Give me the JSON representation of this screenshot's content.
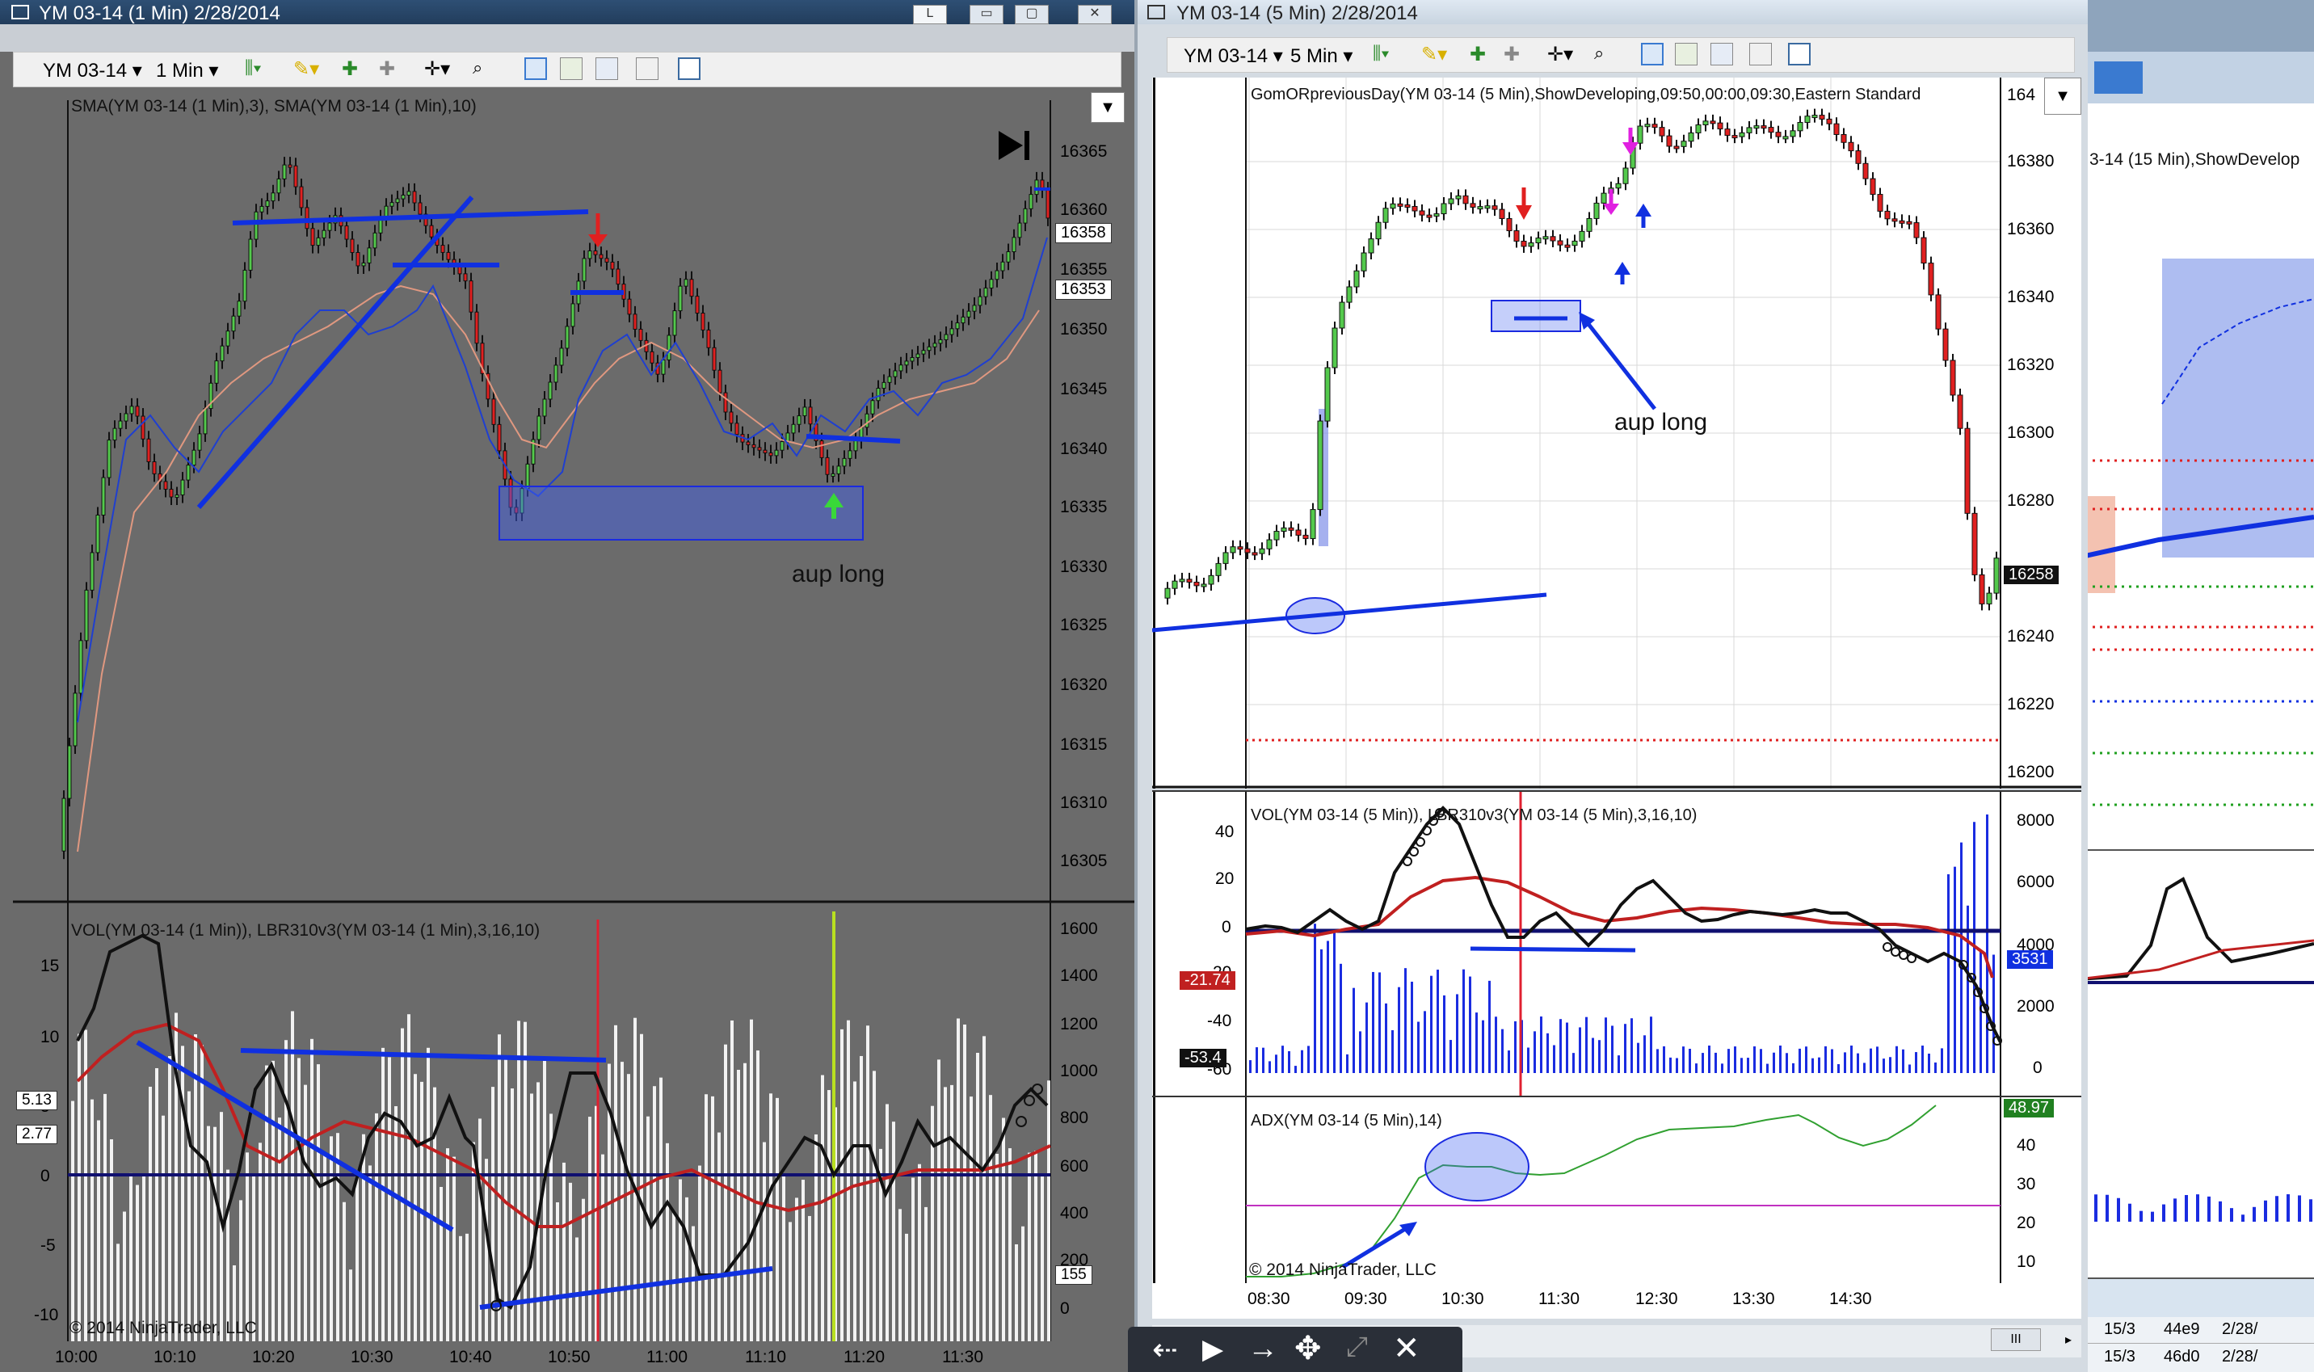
{
  "left_window": {
    "title": "YM 03-14 (1 Min)  2/28/2014",
    "toolbar": {
      "instrument": "YM 03-14",
      "interval": "1 Min"
    },
    "price_panel": {
      "indicator_label": "SMA(YM 03-14 (1 Min),3), SMA(YM 03-14 (1 Min),10)",
      "y_ticks": [
        "16365",
        "16360",
        "16355",
        "16350",
        "16345",
        "16340",
        "16335",
        "16330",
        "16325",
        "16320",
        "16315",
        "16310",
        "16305"
      ],
      "price_tags": [
        {
          "text": "16358",
          "bg": "#ffffff",
          "fg": "#000000"
        },
        {
          "text": "16353",
          "bg": "#ffffff",
          "fg": "#000000"
        }
      ],
      "annotation": "aup long"
    },
    "lower_panel": {
      "indicator_label": "VOL(YM 03-14 (1 Min)), LBR310v3(YM 03-14 (1 Min),3,16,10)",
      "y_ticks_left": [
        "15",
        "10",
        "5",
        "0",
        "-5",
        "-10"
      ],
      "y_ticks_right": [
        "1600",
        "1400",
        "1200",
        "1000",
        "800",
        "600",
        "400",
        "200",
        "0"
      ],
      "tags_left": [
        "5.13",
        "2.77"
      ],
      "tag_right": "155",
      "copyright": "© 2014 NinjaTrader, LLC"
    },
    "x_ticks": [
      "10:00",
      "10:10",
      "10:20",
      "10:30",
      "10:40",
      "10:50",
      "11:00",
      "11:10",
      "11:20",
      "11:30"
    ]
  },
  "right_window": {
    "title": "YM 03-14 (5 Min)  2/28/2014",
    "toolbar": {
      "instrument": "YM 03-14",
      "interval": "5 Min"
    },
    "price_panel": {
      "indicator_label": "GomORpreviousDay(YM 03-14 (5 Min),ShowDeveloping,09:50,00:00,09:30,Eastern Standard",
      "y_ticks": [
        "164",
        "16380",
        "16360",
        "16340",
        "16320",
        "16300",
        "16280",
        "16260",
        "16240",
        "16220",
        "16200"
      ],
      "last_price_tag": "16258",
      "annotation": "aup long"
    },
    "vol_panel": {
      "indicator_label": "VOL(YM 03-14 (5 Min)), LBR310v3(YM 03-14 (5 Min),3,16,10)",
      "y_ticks_left": [
        "40",
        "20",
        "0",
        "-20",
        "-40",
        "-60"
      ],
      "y_ticks_right": [
        "8000",
        "6000",
        "4000",
        "2000",
        "0"
      ],
      "tag_red": "-21.74",
      "tag_black": "-53.4",
      "tag_blue": "3531"
    },
    "adx_panel": {
      "indicator_label": "ADX(YM 03-14 (5 Min),14)",
      "y_ticks": [
        "40",
        "30",
        "20",
        "10"
      ],
      "tag_green": "48.97",
      "copyright": "© 2014 NinjaTrader, LLC"
    },
    "x_ticks": [
      "08:30",
      "09:30",
      "10:30",
      "11:30",
      "12:30",
      "13:30",
      "14:30"
    ],
    "scroll_label": "III"
  },
  "third_window": {
    "label": "3-14 (15 Min),ShowDevelop",
    "table_rows": [
      [
        "15/3",
        "44e9",
        "2/28/"
      ],
      [
        "15/3",
        "46d0",
        "2/28/"
      ]
    ]
  },
  "drawing_toolbar": {
    "icons": [
      "arrow-left-icon",
      "play-icon",
      "arrow-right-icon",
      "move-icon",
      "resize-icon",
      "close-icon"
    ]
  },
  "colors": {
    "left_bg": "#6b6b6b",
    "right_bg": "#ffffff",
    "bull": "#53c94c",
    "bear": "#e02020",
    "sma_fast": "#1f3fd0",
    "sma_slow": "#e09880",
    "trend": "#1030e0",
    "zone": "#4060f0"
  }
}
